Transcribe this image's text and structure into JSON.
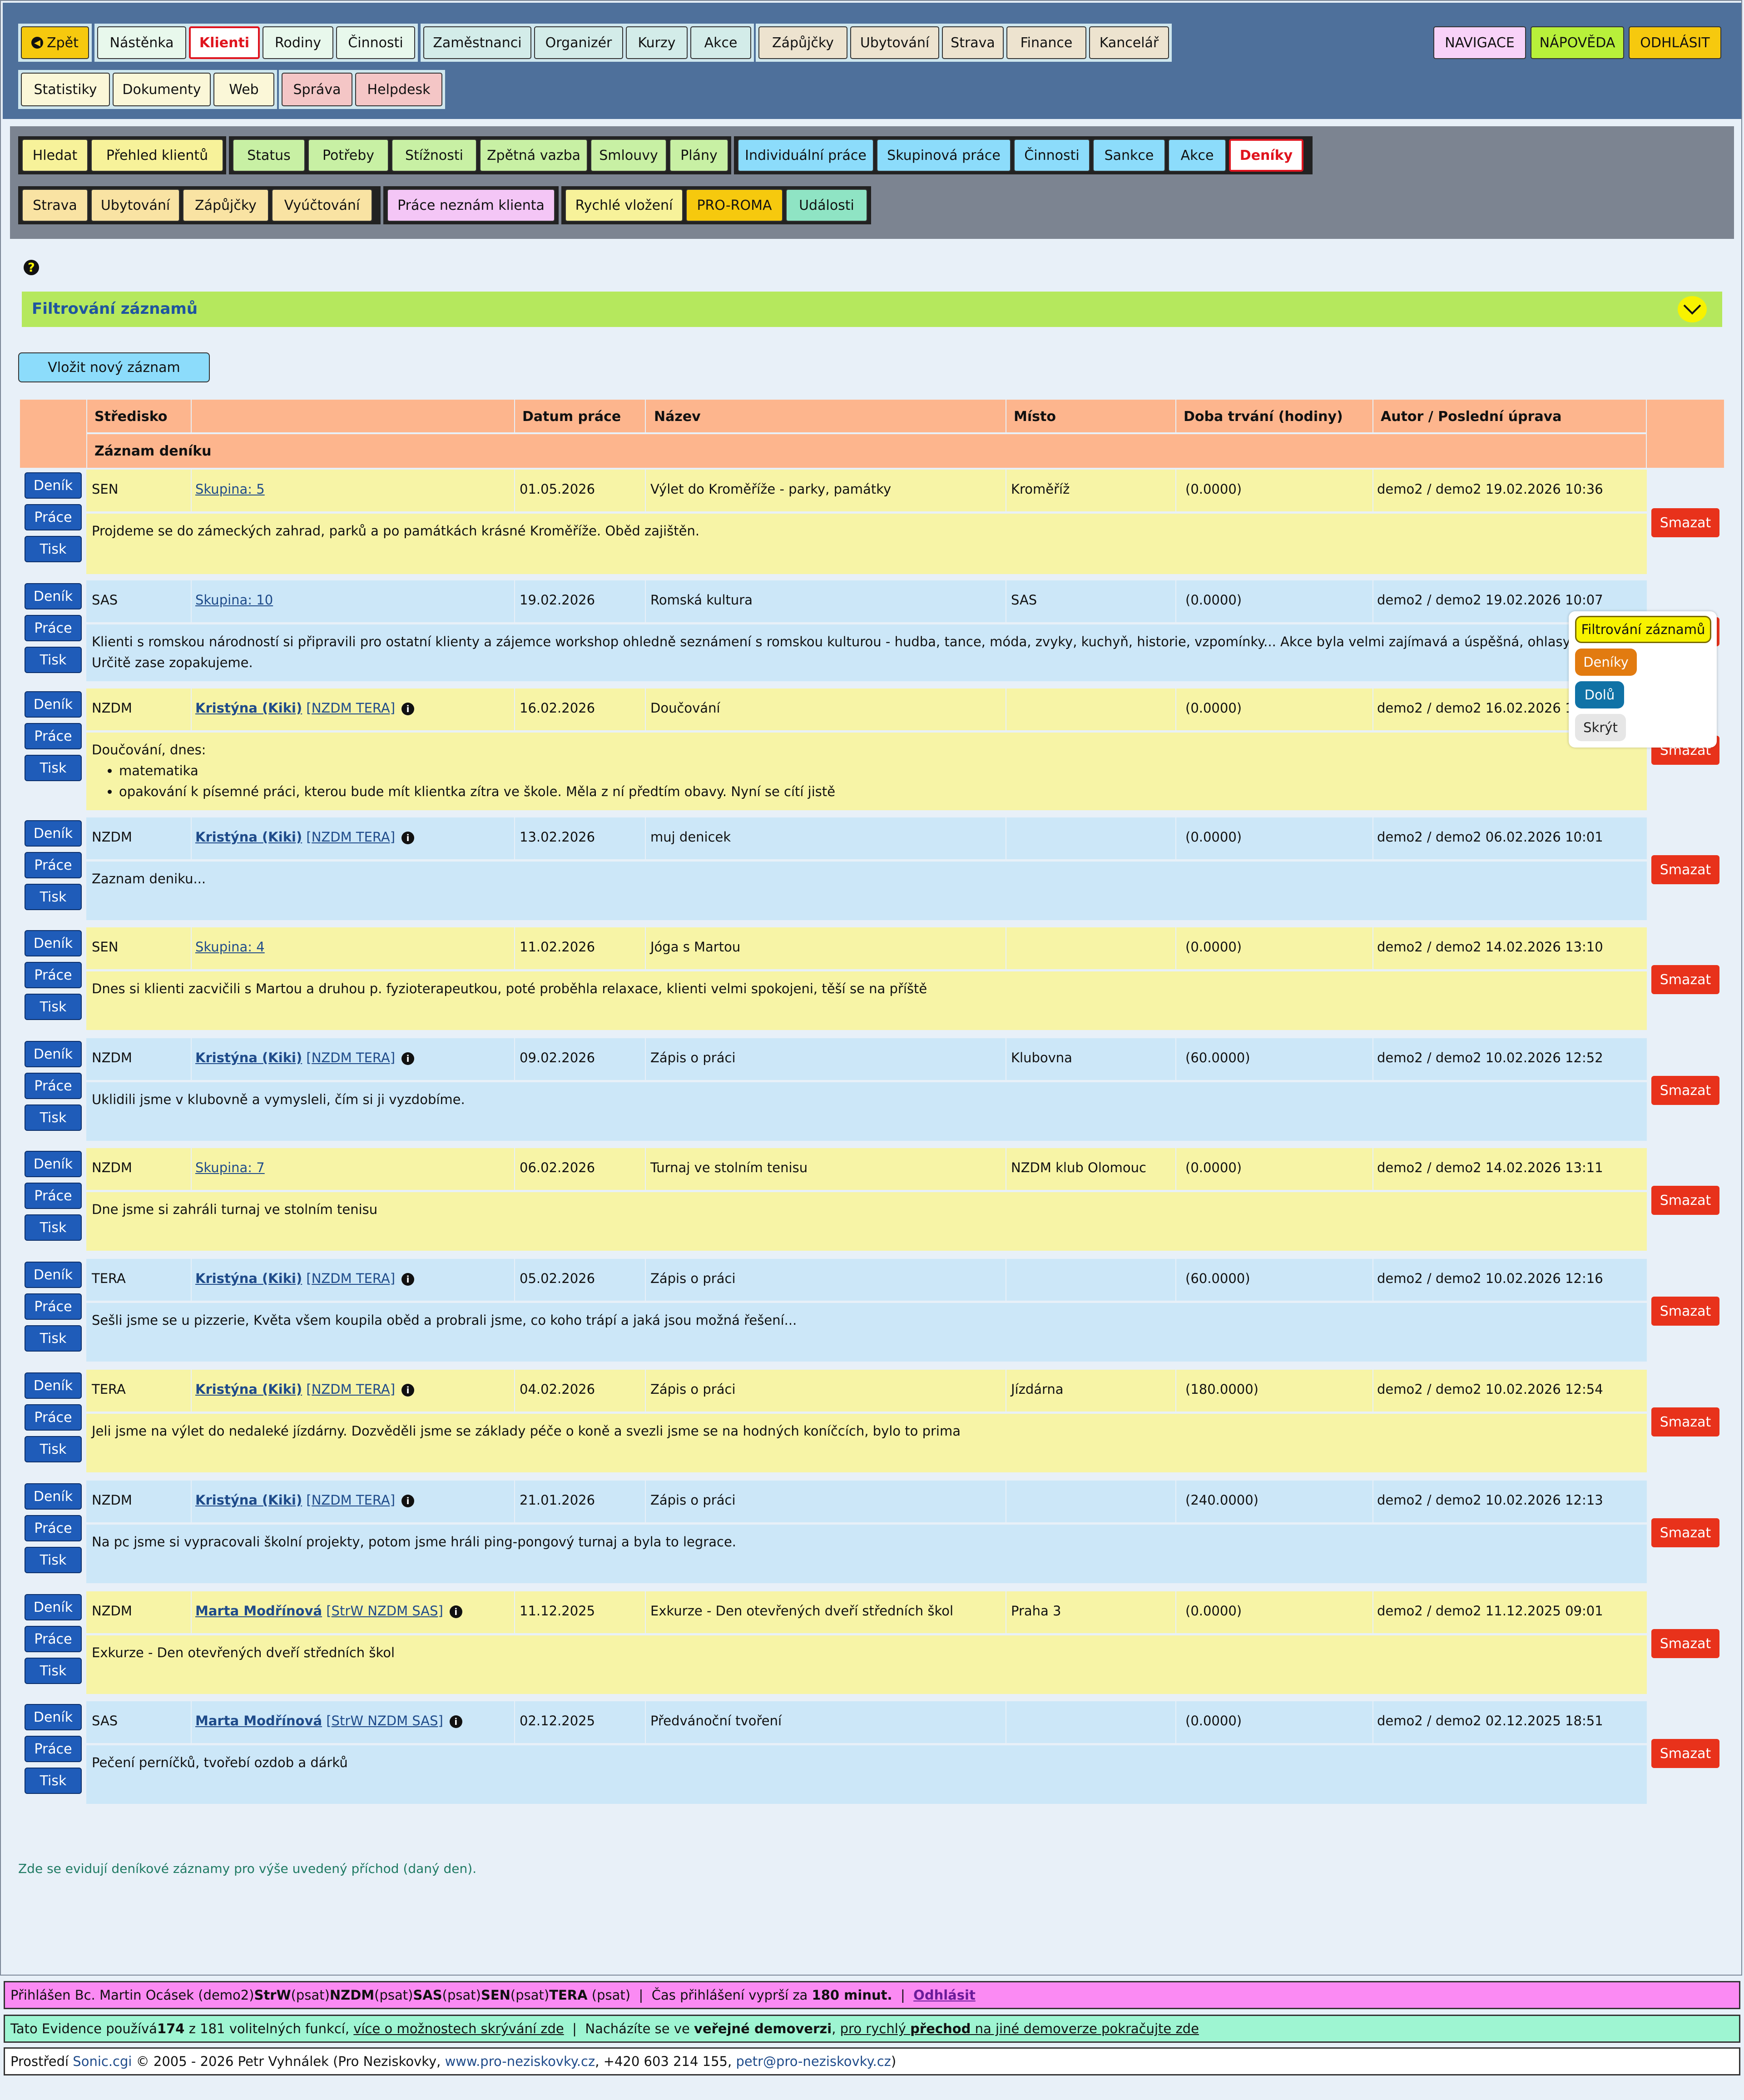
{
  "topnav": {
    "back": "Zpět",
    "row1": [
      "Nástěnka",
      "Klienti",
      "Rodiny",
      "Činnosti",
      "Zaměstnanci",
      "Organizér",
      "Kurzy",
      "Akce",
      "Zápůjčky",
      "Ubytování",
      "Strava",
      "Finance",
      "Kancelář"
    ],
    "row2": [
      "Statistiky",
      "Dokumenty",
      "Web",
      "Správa",
      "Helpdesk"
    ],
    "right": [
      "NAVIGACE",
      "NÁPOVĚDA",
      "ODHLÁSIT"
    ]
  },
  "subnav": {
    "row1": [
      "Hledat",
      "Přehled klientů",
      "Status",
      "Potřeby",
      "Stížnosti",
      "Zpětná vazba",
      "Smlouvy",
      "Plány",
      "Individuální práce",
      "Skupinová práce",
      "Činnosti",
      "Sankce",
      "Akce",
      "Deníky"
    ],
    "row2": [
      "Strava",
      "Ubytování",
      "Zápůjčky",
      "Vyúčtování",
      "Práce neznám klienta",
      "Rychlé vložení",
      "PRO-ROMA",
      "Události"
    ]
  },
  "help_icon": "?",
  "filter_title": "Filtrování záznamů",
  "new_record": "Vložit nový záznam",
  "table": {
    "headers": {
      "center": "Středisko",
      "date": "Datum práce",
      "name": "Název",
      "place": "Místo",
      "duration": "Doba trvání (hodiny)",
      "author": "Autor / Poslední úprava",
      "record": "Záznam deníku"
    },
    "buttons": {
      "diary": "Deník",
      "work": "Práce",
      "print": "Tisk",
      "delete": "Smazat"
    },
    "rows": [
      {
        "center": "SEN",
        "client": "Skupina: 5",
        "date": "01.05.2026",
        "name": "Výlet do Kroměříže - parky, památky",
        "place": "Kroměříž",
        "duration": "(0.0000)",
        "author": "demo2 / demo2 19.02.2026 10:36",
        "text": "Projdeme se do zámeckých zahrad, parků a po památkách krásné Kroměříže. Oběd zajištěn."
      },
      {
        "center": "SAS",
        "client": "Skupina: 10",
        "date": "19.02.2026",
        "name": "Romská kultura",
        "place": "SAS",
        "duration": "(0.0000)",
        "author": "demo2 / demo2 19.02.2026 10:07",
        "text": "Klienti s romskou národností si připravili pro ostatní klienty a zájemce workshop ohledně seznámení s romskou kulturou - hudba, tance, móda, zvyky, kuchyň, historie, vzpomínky... Akce byla velmi zajímavá a úspěšná, ohlasy",
        "text2": "Určitě zase zopakujeme."
      },
      {
        "center": "NZDM",
        "client": "Kristýna (Kiki)",
        "client_tag": "[NZDM TERA]",
        "date": "16.02.2026",
        "name": "Doučování",
        "place": "",
        "duration": "(0.0000)",
        "author": "demo2 / demo2 16.02.2026 1",
        "text": "Doučování, dnes:",
        "items": [
          "matematika",
          "opakování k písemné práci, kterou bude mít klientka zítra ve škole. Měla z ní předtím obavy. Nyní se cítí jistě"
        ]
      },
      {
        "center": "NZDM",
        "client": "Kristýna (Kiki)",
        "client_tag": "[NZDM TERA]",
        "date": "13.02.2026",
        "name": "muj denicek",
        "place": "",
        "duration": "(0.0000)",
        "author": "demo2 / demo2 06.02.2026 10:01",
        "text": "Zaznam deniku..."
      },
      {
        "center": "SEN",
        "client": "Skupina: 4",
        "date": "11.02.2026",
        "name": "Jóga s Martou",
        "place": "",
        "duration": "(0.0000)",
        "author": "demo2 / demo2 14.02.2026 13:10",
        "text": "Dnes si klienti zacvičili s Martou a druhou p. fyzioterapeutkou, poté proběhla relaxace, klienti velmi spokojeni, těší se na příště"
      },
      {
        "center": "NZDM",
        "client": "Kristýna (Kiki)",
        "client_tag": "[NZDM TERA]",
        "date": "09.02.2026",
        "name": "Zápis o práci",
        "place": "Klubovna",
        "duration": "(60.0000)",
        "author": "demo2 / demo2 10.02.2026 12:52",
        "text": "Uklidili jsme v klubovně a vymysleli, čím si ji vyzdobíme."
      },
      {
        "center": "NZDM",
        "client": "Skupina: 7",
        "date": "06.02.2026",
        "name": "Turnaj ve stolním tenisu",
        "place": "NZDM klub Olomouc",
        "duration": "(0.0000)",
        "author": "demo2 / demo2 14.02.2026 13:11",
        "text": "Dne jsme si zahráli turnaj ve stolním tenisu"
      },
      {
        "center": "TERA",
        "client": "Kristýna (Kiki)",
        "client_tag": "[NZDM TERA]",
        "date": "05.02.2026",
        "name": "Zápis o práci",
        "place": "",
        "duration": "(60.0000)",
        "author": "demo2 / demo2 10.02.2026 12:16",
        "text": "Sešli jsme se u pizzerie, Květa všem koupila oběd a probrali jsme, co koho trápí a jaká jsou možná řešení..."
      },
      {
        "center": "TERA",
        "client": "Kristýna (Kiki)",
        "client_tag": "[NZDM TERA]",
        "date": "04.02.2026",
        "name": "Zápis o práci",
        "place": "Jízdárna",
        "duration": "(180.0000)",
        "author": "demo2 / demo2 10.02.2026 12:54",
        "text": "Jeli jsme na výlet do nedaleké jízdárny. Dozvěděli jsme se základy péče o koně a svezli jsme se na hodných koníčcích, bylo to prima"
      },
      {
        "center": "NZDM",
        "client": "Kristýna (Kiki)",
        "client_tag": "[NZDM TERA]",
        "date": "21.01.2026",
        "name": "Zápis o práci",
        "place": "",
        "duration": "(240.0000)",
        "author": "demo2 / demo2 10.02.2026 12:13",
        "text": "Na pc jsme si vypracovali školní projekty, potom jsme hráli ping-pongový turnaj a byla to legrace."
      },
      {
        "center": "NZDM",
        "client": "Marta Modřínová",
        "client_tag": "[StrW NZDM SAS]",
        "date": "11.12.2025",
        "name": "Exkurze - Den otevřených dveří středních škol",
        "place": "Praha 3",
        "duration": "(0.0000)",
        "author": "demo2 / demo2 11.12.2025 09:01",
        "text": "Exkurze - Den otevřených dveří středních škol"
      },
      {
        "center": "SAS",
        "client": "Marta Modřínová",
        "client_tag": "[StrW NZDM SAS]",
        "date": "02.12.2025",
        "name": "Předvánoční tvoření",
        "place": "",
        "duration": "(0.0000)",
        "author": "demo2 / demo2 02.12.2025 18:51",
        "text": "Pečení perníčků, tvořebí ozdob a dárků"
      }
    ]
  },
  "popup": {
    "filter": "Filtrování záznamů",
    "diaries": "Deníky",
    "down": "Dolů",
    "hide": "Skrýt"
  },
  "footnote": "Zde se evidují deníkové záznamy pro výše uvedený příchod (daný den).",
  "footer": {
    "login": {
      "a": "Přihlášen Bc. Martin Ocásek (demo2) ",
      "b": "StrW",
      "c": " (psat) ",
      "d": "NZDM",
      "e": " (psat) ",
      "f": "SAS",
      "g": " (psat) ",
      "h": "SEN",
      "i": " (psat) ",
      "j": "TERA",
      "k": " (psat)  |  Čas přihlášení vyprší za ",
      "l": "180 minut.",
      "m": "  |  ",
      "n": "Odhlásit"
    },
    "info": {
      "a": "Tato Evidence používá ",
      "b": "174",
      "c": " z 181 volitelných funkcí, ",
      "d": "více o možnostech skrývání zde",
      "e": "  |  Nacházíte se ve ",
      "f": "veřejné demoverzi",
      "g": ", ",
      "h": "pro rychlý ",
      "i": "přechod",
      "j": " na jiné demoverze pokračujte zde"
    },
    "copyright": {
      "a": "Prostředí ",
      "b": "Sonic.cgi",
      "c": " © 2005 - 2026 Petr Vyhnálek (Pro Neziskovky, ",
      "d": "www.pro-neziskovky.cz",
      "e": ", +420 603 214 155, ",
      "f": "petr@pro-neziskovky.cz",
      "g": ")"
    }
  },
  "colors": {
    "topbar": "#4e709b",
    "subbar": "#7c8491",
    "row_yellow": "#f7f4a6",
    "row_blue": "#cce7f8",
    "header": "#fdb58d",
    "delete": "#e8321b",
    "side_button": "#1f5cb9"
  }
}
